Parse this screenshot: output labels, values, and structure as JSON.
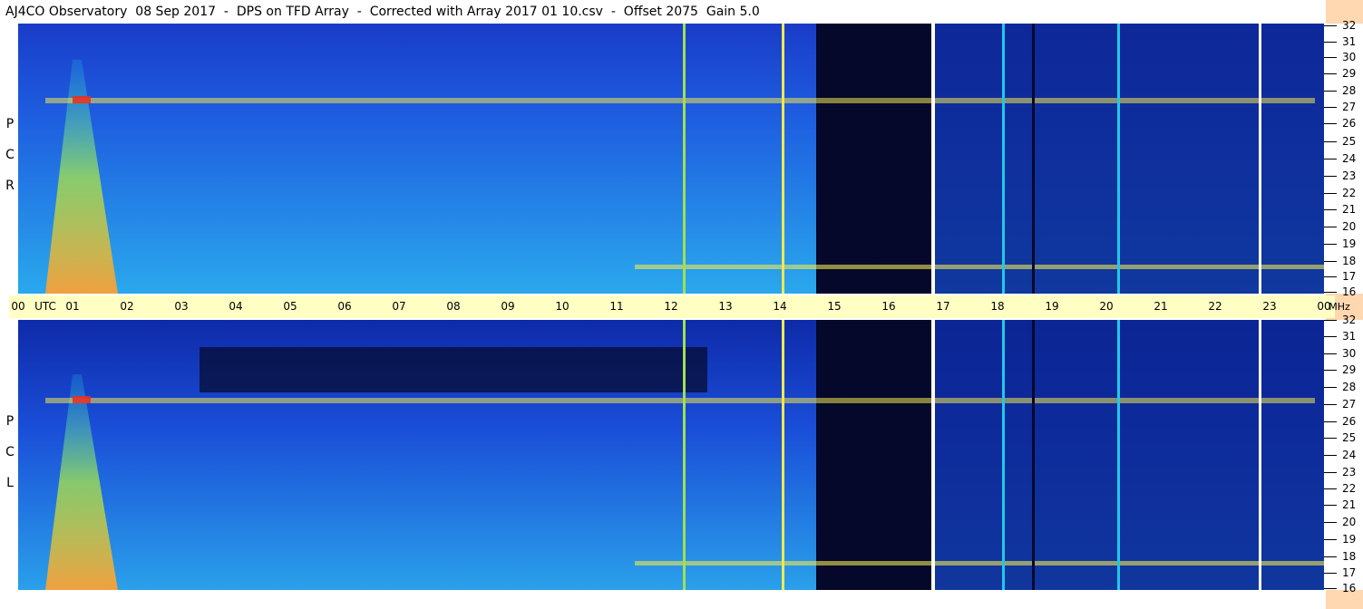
{
  "title": "AJ4CO Observatory  08 Sep 2017  -  DPS on TFD Array  -  Corrected with Array 2017 01 10.csv  -  Offset 2075  Gain 5.0",
  "panels": {
    "top": {
      "pol_letters": [
        "P",
        "C",
        "R"
      ]
    },
    "bottom": {
      "pol_letters": [
        "P",
        "C",
        "L"
      ]
    }
  },
  "time_axis": {
    "labels": [
      "00",
      "UTC",
      "01",
      "02",
      "03",
      "04",
      "05",
      "06",
      "07",
      "08",
      "09",
      "10",
      "11",
      "12",
      "13",
      "14",
      "15",
      "16",
      "17",
      "18",
      "19",
      "20",
      "21",
      "22",
      "23",
      "00",
      "MHz"
    ]
  },
  "freq_axis": {
    "labels": [
      "32",
      "31",
      "30",
      "29",
      "28",
      "27",
      "26",
      "25",
      "24",
      "23",
      "22",
      "21",
      "20",
      "19",
      "18",
      "17",
      "16"
    ]
  },
  "colors": {
    "base": "#1a4fd8",
    "dark": "#05082a",
    "cyan": "#22c8e8",
    "yellow": "#f0e850",
    "red": "#e83020",
    "axis_bg": "#ffffc4",
    "right_bg": "#ffd7b0"
  }
}
